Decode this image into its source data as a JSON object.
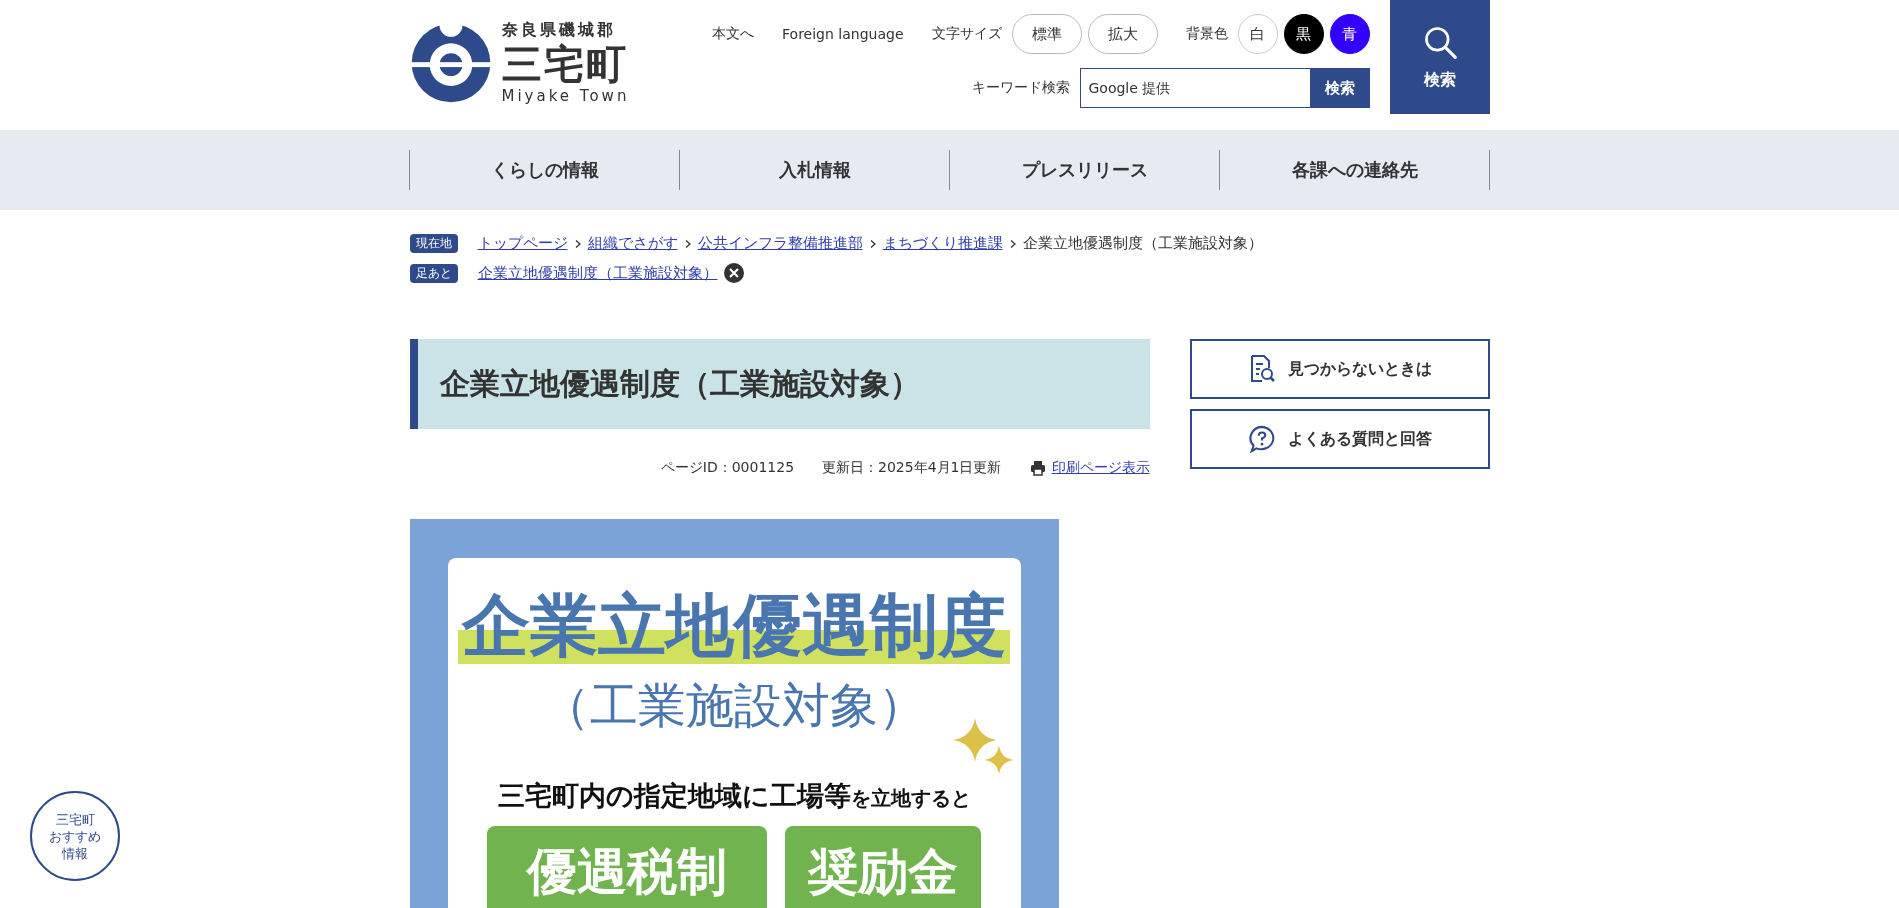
{
  "header": {
    "prefecture": "奈良県磯城郡",
    "town": "三宅町",
    "town_en": "Miyake Town",
    "skip_link": "本文へ",
    "foreign_language": "Foreign language",
    "font_size": {
      "label": "文字サイズ",
      "options": [
        "標準",
        "拡大"
      ]
    },
    "background": {
      "label": "背景色",
      "options": [
        {
          "label": "白",
          "kind": "white"
        },
        {
          "label": "黒",
          "kind": "black"
        },
        {
          "label": "青",
          "kind": "blue"
        }
      ]
    },
    "keyword_search": {
      "label": "キーワード検索",
      "placeholder": "Google 提供",
      "button": "検索"
    },
    "search_button": "検索"
  },
  "nav": [
    "くらしの情報",
    "入札情報",
    "プレスリリース",
    "各課への連絡先"
  ],
  "breadcrumb": {
    "label": "現在地",
    "links": [
      "トップページ",
      "組織でさがす",
      "公共インフラ整備推進部",
      "まちづくり推進課"
    ],
    "current": "企業立地優遇制度（工業施設対象）"
  },
  "footprints": {
    "label": "足あと",
    "items": [
      "企業立地優遇制度（工業施設対象）"
    ]
  },
  "page": {
    "title": "企業立地優遇制度（工業施設対象）",
    "page_id": "ページID：0001125",
    "updated": "更新日：2025年4月1日更新",
    "print_link": "印刷ページ表示"
  },
  "banner": {
    "title": "企業立地優遇制度",
    "subtitle": "（工業施設対象）",
    "lead_main": "三宅町内の指定地域に工場等",
    "lead_small": "を立地すると",
    "benefits": [
      "優遇税制",
      "奨励金"
    ]
  },
  "side_links": [
    {
      "label": "見つからないときは",
      "kind": "search"
    },
    {
      "label": "よくある質問と回答",
      "kind": "faq"
    }
  ],
  "floating_badge": [
    "三宅町",
    "おすすめ",
    "情報"
  ]
}
